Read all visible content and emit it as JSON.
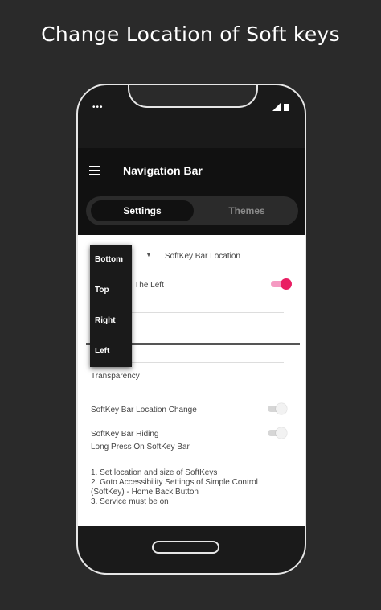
{
  "headline": "Change Location of Soft keys",
  "status_bar": {
    "dots": "•••"
  },
  "app_bar": {
    "title": "Navigation Bar"
  },
  "tabs": [
    {
      "label": "Settings"
    },
    {
      "label": "Themes"
    }
  ],
  "settings": {
    "location_label": "SoftKey Bar Location",
    "partial_label": "n The Left",
    "transparency_label": "Transparency",
    "location_change_label": "SoftKey Bar Location Change",
    "hiding_label": "SoftKey Bar Hiding",
    "long_press_label": "Long Press On SoftKey Bar",
    "instructions": [
      "1. Set location and size of SoftKeys",
      "2. Goto Accessibility Settings of Simple Control",
      "(SoftKey) - Home Back Button",
      "3. Service must be on"
    ]
  },
  "dropdown": {
    "options": [
      "Bottom",
      "Top",
      "Right",
      "Left"
    ]
  },
  "colors": {
    "accent": "#e91e63",
    "background": "#2a2a2a"
  }
}
